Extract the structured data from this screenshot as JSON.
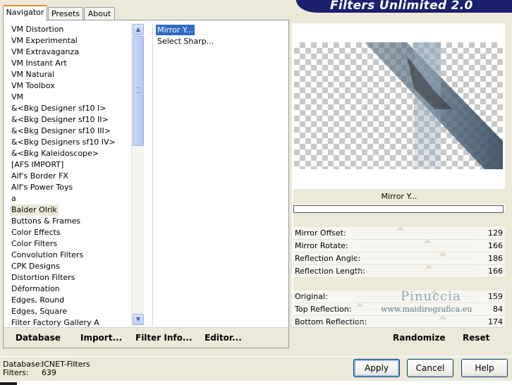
{
  "title": "Filters Unlimited 2.0",
  "tabs": [
    {
      "label": "Navigator",
      "active": true
    },
    {
      "label": "Presets",
      "active": false
    },
    {
      "label": "About",
      "active": false
    }
  ],
  "categories": [
    "VM Distortion",
    "VM Experimental",
    "VM Extravaganza",
    "VM Instant Art",
    "VM Natural",
    "VM Toolbox",
    "VM",
    "&<Bkg Designer sf10 I>",
    "&<Bkg Designer sf10 II>",
    "&<Bkg Designer sf10 III>",
    "&<Bkg Designers sf10 IV>",
    "&<Bkg Kaleidoscope>",
    "[AFS IMPORT]",
    "Alf's Border FX",
    "Alf's Power Toys",
    "a",
    "Balder Olrik",
    "Buttons & Frames",
    "Color Effects",
    "Color Filters",
    "Convolution Filters",
    "CPK Designs",
    "Distortion Filters",
    "Déformation",
    "Edges, Round",
    "Edges, Square",
    "Filter Factory Gallery A"
  ],
  "selected_category": "Balder Olrik",
  "filters": [
    "Mirror Y...",
    "Select Sharp..."
  ],
  "selected_filter": "Mirror Y...",
  "left_buttons": {
    "database": "Database",
    "import": "Import...",
    "filter_info": "Filter Info...",
    "editor": "Editor..."
  },
  "preview_filter_name": "Mirror Y...",
  "controls_group1": [
    {
      "label": "Mirror Offset:",
      "value": "129"
    },
    {
      "label": "Mirror Rotate:",
      "value": "166"
    },
    {
      "label": "Reflection Angle:",
      "value": "186"
    },
    {
      "label": "Reflection Length:",
      "value": "166"
    }
  ],
  "controls_group2": [
    {
      "label": "Original:",
      "value": "159"
    },
    {
      "label": "Top Reflection:",
      "value": "84"
    },
    {
      "label": "Bottom Reflection:",
      "value": "174"
    }
  ],
  "right_buttons": {
    "randomize": "Randomize",
    "reset": "Reset"
  },
  "watermark": {
    "name": "Pinuccia",
    "site": "www.maidiregrafica.eu"
  },
  "footer": {
    "database_label": "Database:",
    "database_value": "ICNET-Filters",
    "filters_label": "Filters:",
    "filters_value": "639"
  },
  "dialog_buttons": {
    "apply": "Apply",
    "cancel": "Cancel",
    "help": "Help"
  },
  "colors": {
    "banner": "#1a1f6e",
    "selection": "#316ac5",
    "dialog_bg": "#ece9d8"
  }
}
